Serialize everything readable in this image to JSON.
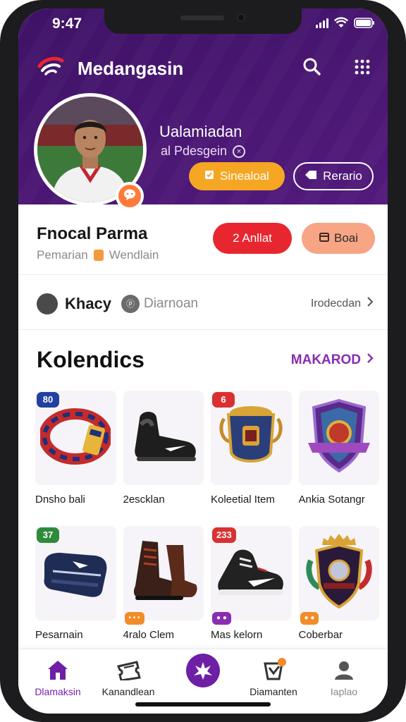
{
  "status_bar": {
    "time": "9:47"
  },
  "app": {
    "title": "Medangasin"
  },
  "header": {
    "user_name": "Ualamiadan",
    "user_sub": "al Pdesgein",
    "primary_button": "Sinealoal",
    "secondary_button": "Rerario"
  },
  "profile": {
    "name": "Fnocal Parma",
    "role_left": "Pemarian",
    "role_right": "Wendlain",
    "red_button": "2 Anllat",
    "peach_button": "Boai"
  },
  "club": {
    "name": "Khacy",
    "sub": "Diarnoan",
    "more": "Irodecdan"
  },
  "collection": {
    "title": "Kolendics",
    "link": "MAKAROD",
    "items": [
      {
        "label": "Dnsho bali",
        "tag": "80",
        "tag_color": "blue",
        "icon": "scarf-icon"
      },
      {
        "label": "2escklan",
        "tag": "",
        "tag_color": "",
        "icon": "boot-icon"
      },
      {
        "label": "Koleetial Item",
        "tag": "6",
        "tag_color": "red",
        "icon": "trophy-shield-icon"
      },
      {
        "label": "Ankia Sotangr",
        "tag": "",
        "tag_color": "",
        "icon": "badge-shield-icon"
      },
      {
        "label": "Pesarnain",
        "tag": "37",
        "tag_color": "green",
        "icon": "bag-icon"
      },
      {
        "label": "4ralo Clem",
        "tag": "",
        "tag_color": "",
        "icon": "high-boot-icon",
        "chip": "orange"
      },
      {
        "label": "Mas kelorn",
        "tag": "233",
        "tag_color": "red",
        "icon": "sneaker-icon",
        "chip": "purple"
      },
      {
        "label": "Coberbar",
        "tag": "",
        "tag_color": "",
        "icon": "crest-icon",
        "chip": "orange"
      }
    ]
  },
  "bottom_nav": {
    "items": [
      {
        "label": "Dlamaksin",
        "icon": "home-icon"
      },
      {
        "label": "Kanandlean",
        "icon": "ticket-icon"
      },
      {
        "label": "",
        "icon": "center-emblem-icon"
      },
      {
        "label": "Diamanten",
        "icon": "cart-icon"
      },
      {
        "label": "Iaplao",
        "icon": "profile-icon"
      }
    ]
  },
  "colors": {
    "header_purple": "#4a1773",
    "accent_orange": "#f5a623",
    "accent_red": "#e8262f",
    "accent_peach": "#f7a585",
    "link_purple": "#8a2cb0"
  }
}
